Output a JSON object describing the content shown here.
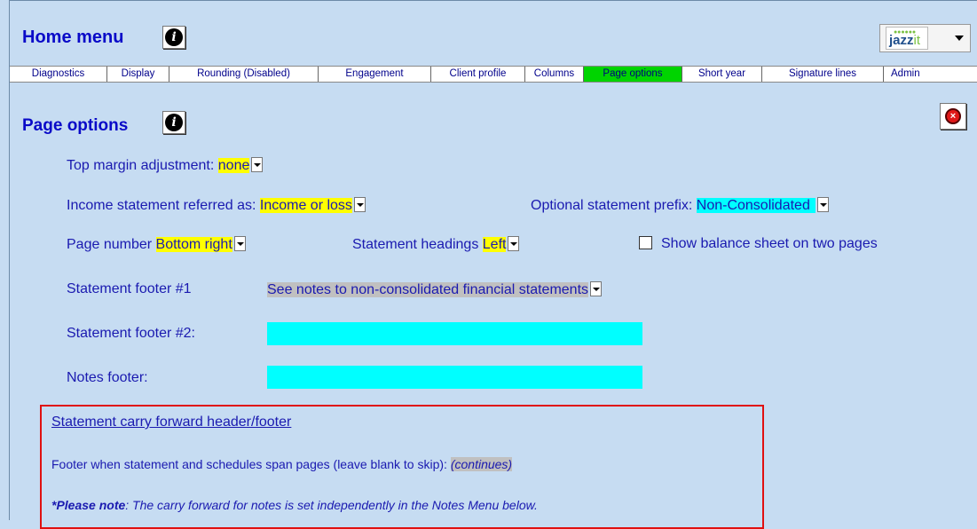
{
  "header": {
    "title": "Home menu",
    "logo_text_main": "jazz",
    "logo_text_accent": "it"
  },
  "tabs": [
    {
      "label": "Diagnostics",
      "active": false
    },
    {
      "label": "Display",
      "active": false
    },
    {
      "label": "Rounding (Disabled)",
      "active": false
    },
    {
      "label": "Engagement",
      "active": false
    },
    {
      "label": "Client profile",
      "active": false
    },
    {
      "label": "Columns",
      "active": false
    },
    {
      "label": "Page options",
      "active": true
    },
    {
      "label": "Short year",
      "active": false
    },
    {
      "label": "Signature lines",
      "active": false
    },
    {
      "label": "Admin",
      "active": false
    }
  ],
  "section": {
    "title": "Page options"
  },
  "options": {
    "top_margin_label": "Top margin adjustment:",
    "top_margin_value": "none",
    "income_label": "Income statement referred as:",
    "income_value": "Income or loss",
    "prefix_label": "Optional statement prefix:",
    "prefix_value": "Non-Consolidated",
    "page_number_label": "Page number",
    "page_number_value": "Bottom right",
    "headings_label": "Statement headings",
    "headings_value": "Left",
    "balance_sheet_label": "Show balance sheet on two pages",
    "footer1_label": "Statement footer #1",
    "footer1_value": "See notes to non-consolidated financial statements",
    "footer2_label": "Statement footer #2:",
    "footer2_value": "",
    "notes_footer_label": "Notes footer:",
    "notes_footer_value": ""
  },
  "carry_forward": {
    "title": "Statement carry forward header/footer",
    "footer_label": "Footer when statement and schedules span pages (leave blank to skip):",
    "footer_value": "(continues)",
    "note_bold": "*Please note",
    "note_text": ": The carry forward for notes is set independently in the Notes Menu  below."
  },
  "colors": {
    "background": "#c6dcf2",
    "title_blue": "#0a0ac8",
    "active_tab": "#00d400",
    "highlight_yellow": "#ffff00",
    "highlight_cyan": "#00ffff",
    "highlight_gray": "#c0c0c0",
    "red_border": "#e01010"
  },
  "icons": {
    "info": "info-icon",
    "close": "close-icon",
    "dropdown": "chevron-down-icon"
  }
}
